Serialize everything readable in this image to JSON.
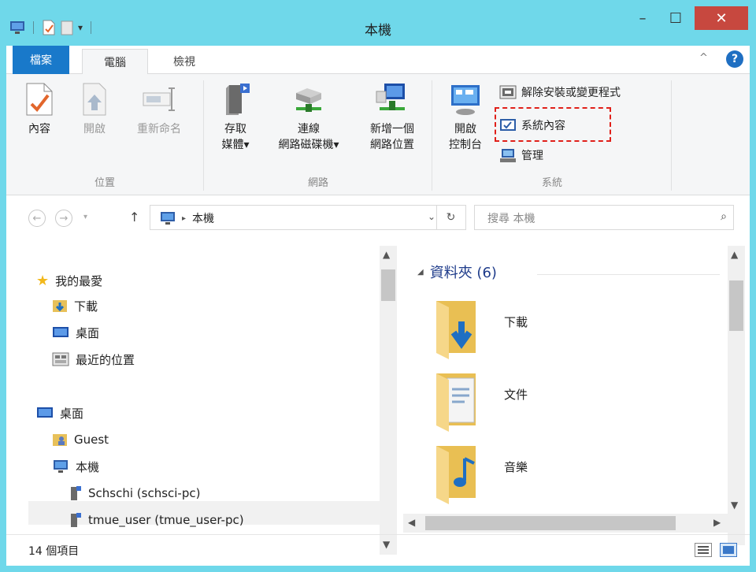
{
  "window": {
    "title": "本機"
  },
  "controls": {
    "minimize": "–",
    "maximize": "☐",
    "close": "✕"
  },
  "ribbon_tabs": {
    "file": "檔案",
    "computer": "電腦",
    "view": "檢視"
  },
  "ribbon": {
    "location": {
      "label": "位置",
      "properties": "內容",
      "open": "開啟",
      "rename": "重新命名"
    },
    "network": {
      "label": "網路",
      "media_line1": "存取",
      "media_line2": "媒體▾",
      "map_line1": "連線",
      "map_line2": "網路磁碟機▾",
      "add_line1": "新增一個",
      "add_line2": "網路位置"
    },
    "system": {
      "label": "系統",
      "cp_line1": "開啟",
      "cp_line2": "控制台",
      "uninstall": "解除安裝或變更程式",
      "sys_props": "系統內容",
      "manage": "管理"
    }
  },
  "address": {
    "location": "本機",
    "search_placeholder": "搜尋 本機"
  },
  "tree": {
    "favorites": "我的最愛",
    "downloads": "下載",
    "desktop_fav": "桌面",
    "recent": "最近的位置",
    "desktop": "桌面",
    "guest": "Guest",
    "this_pc": "本機",
    "schschi": "Schschi (schsci-pc)",
    "tmue": "tmue_user (tmue_user-pc)"
  },
  "content": {
    "section": "資料夾 (6)",
    "folders": [
      "下載",
      "文件",
      "音樂"
    ]
  },
  "status": {
    "items": "14 個項目"
  },
  "colors": {
    "titlebar": "#6fd8ea",
    "file_tab": "#1979ca",
    "close": "#c7483f",
    "highlight": "#e0201a"
  }
}
